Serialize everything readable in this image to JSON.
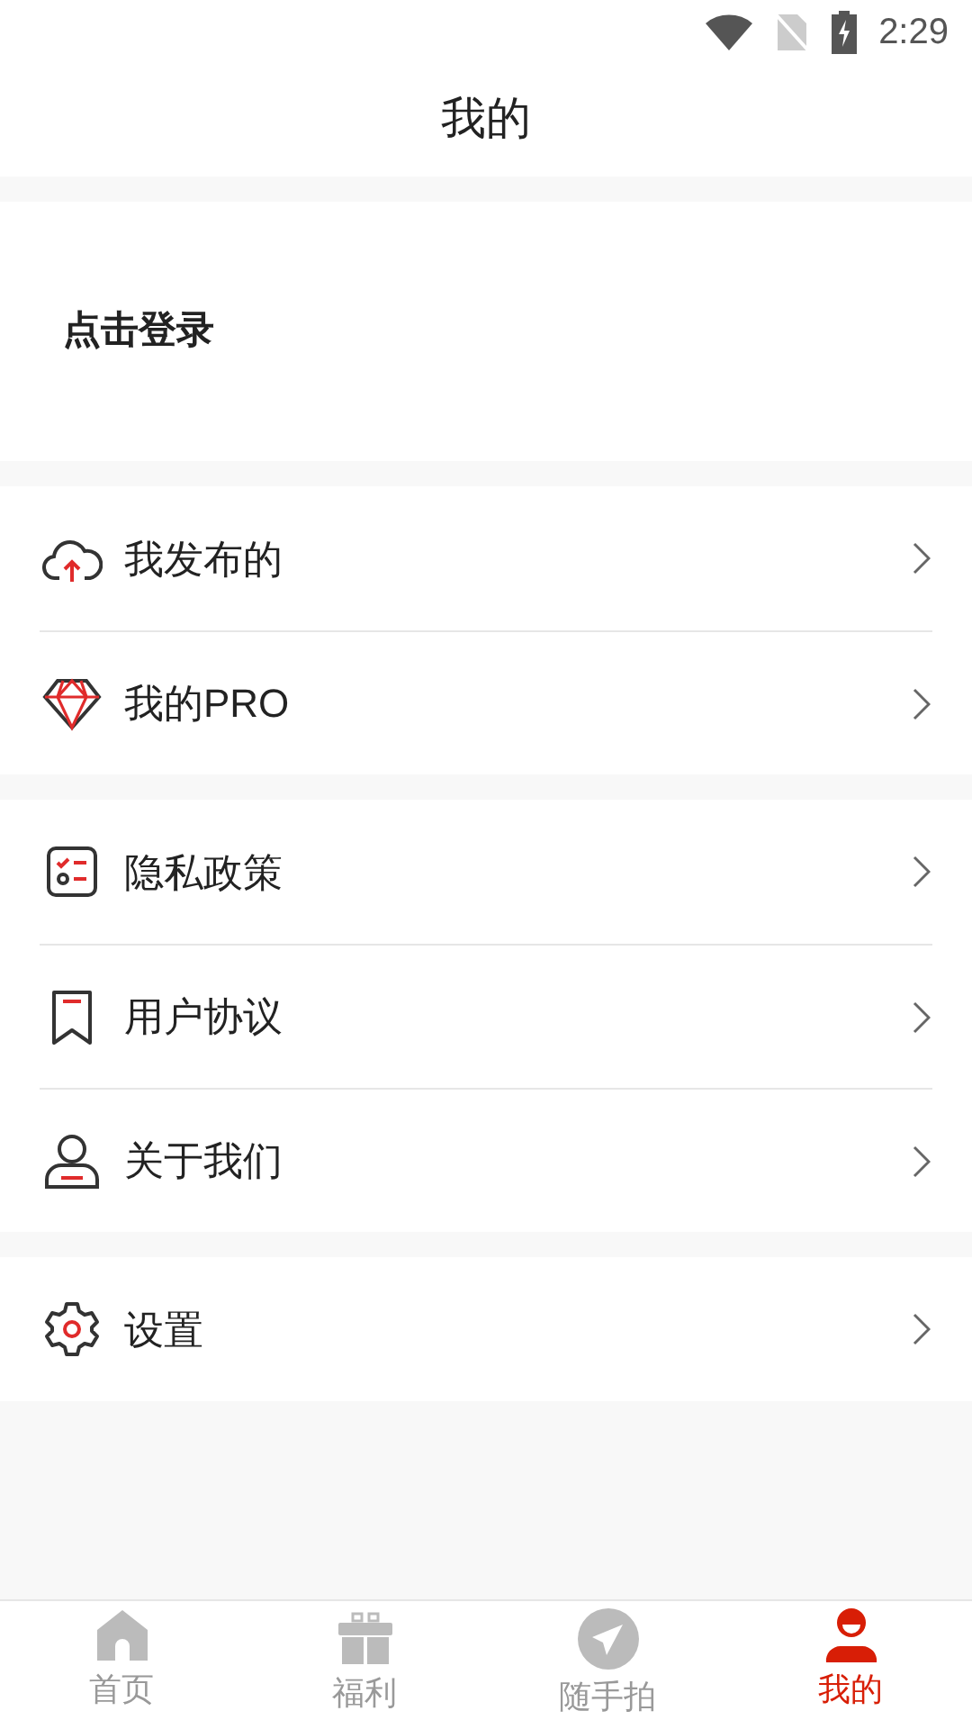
{
  "status_bar": {
    "time": "2:29"
  },
  "header": {
    "title": "我的"
  },
  "login": {
    "label": "点击登录"
  },
  "groups": [
    {
      "items": [
        {
          "label": "我发布的"
        },
        {
          "label": "我的PRO"
        }
      ]
    },
    {
      "items": [
        {
          "label": "隐私政策"
        },
        {
          "label": "用户协议"
        },
        {
          "label": "关于我们"
        }
      ]
    },
    {
      "items": [
        {
          "label": "设置"
        }
      ]
    }
  ],
  "tabs": [
    {
      "label": "首页",
      "selected": false
    },
    {
      "label": "福利",
      "selected": false
    },
    {
      "label": "随手拍",
      "selected": false
    },
    {
      "label": "我的",
      "selected": true
    }
  ]
}
